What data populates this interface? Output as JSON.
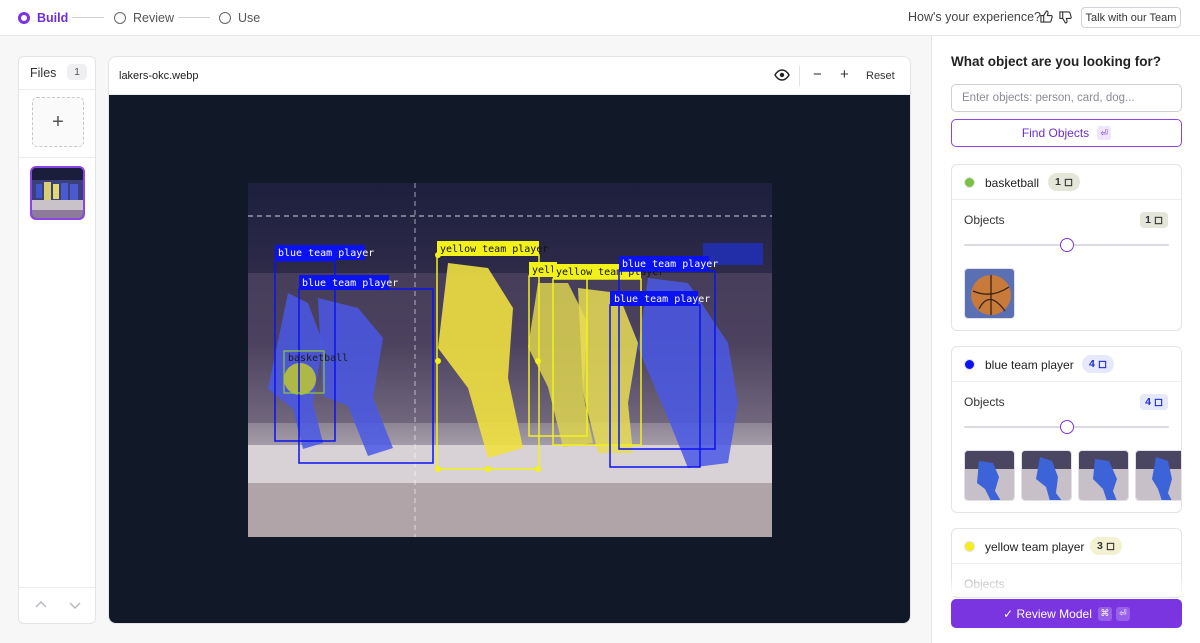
{
  "steps": [
    {
      "label": "Build",
      "active": true
    },
    {
      "label": "Review",
      "active": false
    },
    {
      "label": "Use",
      "active": false
    }
  ],
  "feedback": {
    "question": "How's your experience?",
    "thumbs_up_icon": "thumbs-up-icon",
    "thumbs_down_icon": "thumbs-down-icon",
    "talk_label": "Talk with our Team"
  },
  "files": {
    "title": "Files",
    "count": "1",
    "add_icon": "plus-icon"
  },
  "viewer": {
    "filename": "lakers-okc.webp",
    "zoom_out": "−",
    "zoom_in": "+",
    "reset_label": "Reset"
  },
  "detections": [
    {
      "label": "blue team player",
      "color": "#0b12f0"
    },
    {
      "label": "blue team player",
      "color": "#0b12f0"
    },
    {
      "label": "basketball",
      "color": "#90c83a"
    },
    {
      "label": "yellow team player",
      "color": "#f2f21a"
    },
    {
      "label": "yell",
      "color": "#f2f21a"
    },
    {
      "label": "yellow team player",
      "color": "#f2f21a"
    },
    {
      "label": "blue team player",
      "color": "#0b12f0"
    },
    {
      "label": "blue team player",
      "color": "#0b12f0"
    }
  ],
  "panel": {
    "question": "What object are you looking for?",
    "input_placeholder": "Enter objects: person, card, dog...",
    "find_label": "Find Objects",
    "enter_key": "⏎",
    "cmd_key": "⌘",
    "review_label": "✓ Review Model",
    "objects_label": "Objects",
    "classes": [
      {
        "name": "basketball",
        "count": "1",
        "color": "#7ac142"
      },
      {
        "name": "blue team player",
        "count": "4",
        "color": "#0b12f0"
      },
      {
        "name": "yellow team player",
        "count": "3",
        "color": "#f5ee1c"
      }
    ]
  }
}
